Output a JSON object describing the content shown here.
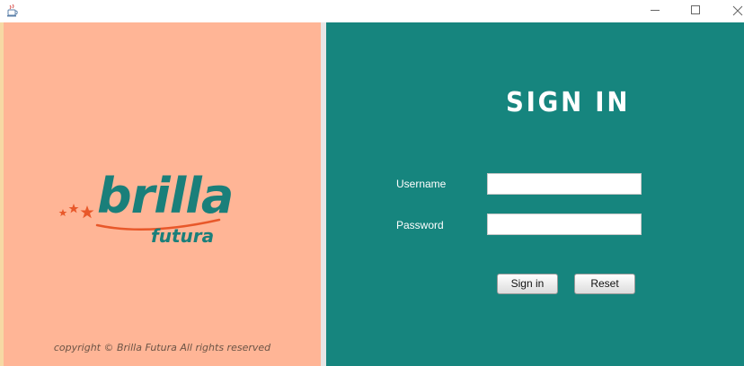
{
  "window": {
    "icon": "java-cup-icon",
    "controls": {
      "minimize": "minimize-icon",
      "maximize": "maximize-icon",
      "close": "close-icon"
    }
  },
  "branding": {
    "logo_word": "brilla",
    "logo_sub": "futura",
    "logo_color": "#1a7f7a",
    "star_color": "#e8582a",
    "copyright": "copyright © Brilla Futura All rights reserved"
  },
  "colors": {
    "left_panel": "#ffb596",
    "right_panel": "#16857e"
  },
  "login": {
    "title": "SIGN IN",
    "username_label": "Username",
    "password_label": "Password",
    "username_value": "",
    "password_value": "",
    "signin_button": "Sign in",
    "reset_button": "Reset"
  }
}
